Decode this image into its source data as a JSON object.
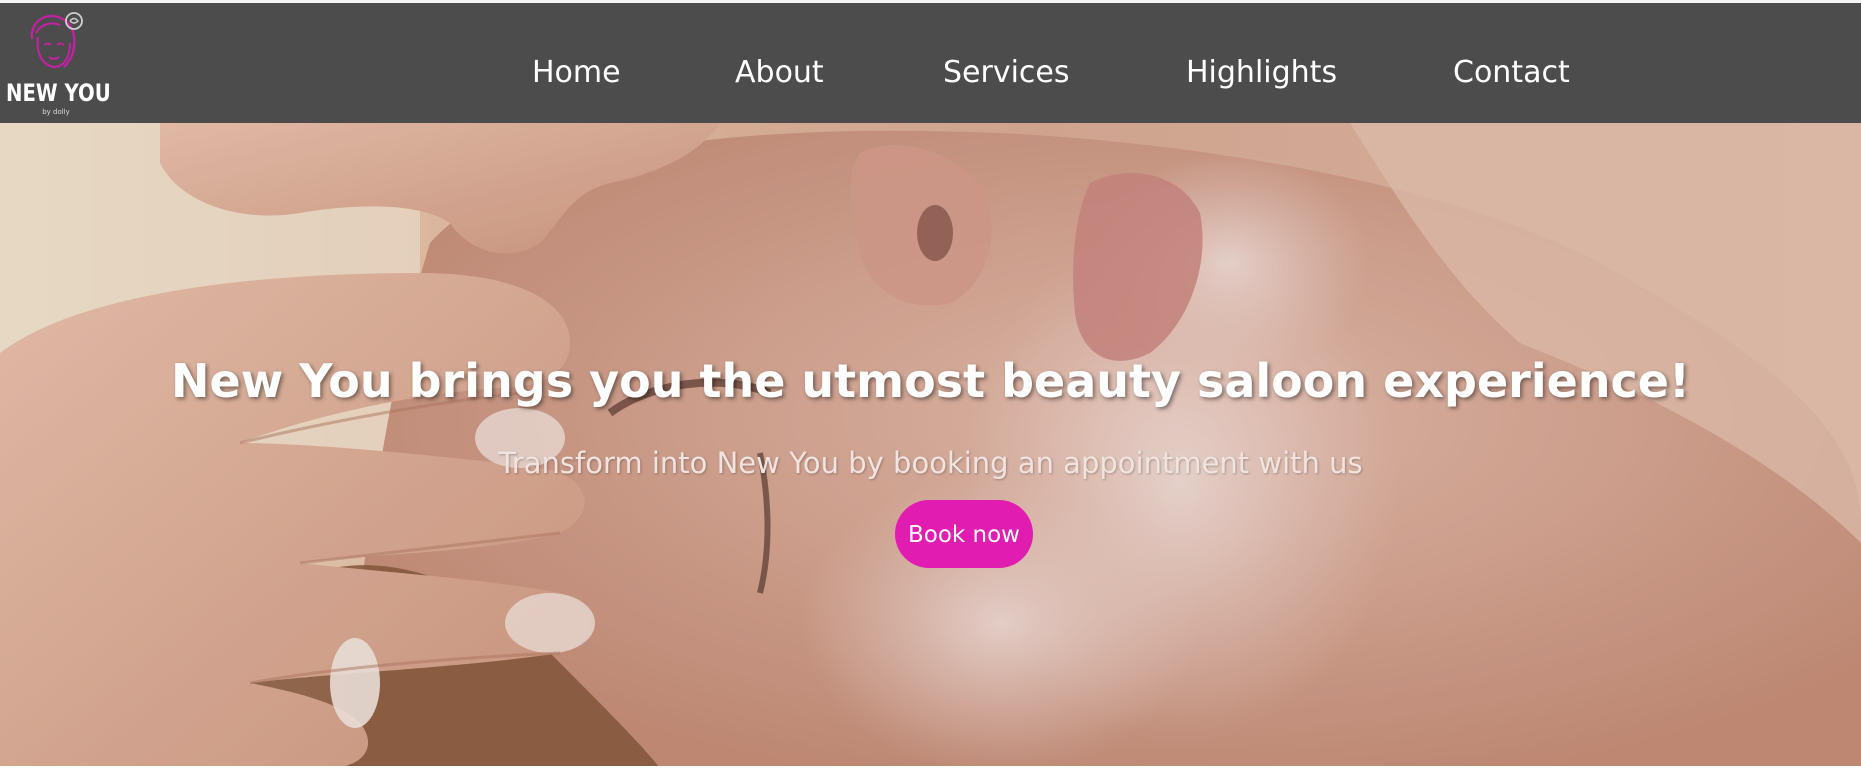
{
  "brand": {
    "name": "NEW YOU",
    "tagline": "by dolly",
    "logo_icon": "woman-face-with-rose-icon",
    "accent_color": "#e01cb1"
  },
  "nav": {
    "items": [
      {
        "label": "Home"
      },
      {
        "label": "About"
      },
      {
        "label": "Services"
      },
      {
        "label": "Highlights"
      },
      {
        "label": "Contact"
      }
    ],
    "background": "#4d4c4d"
  },
  "hero": {
    "title": "New You brings you the utmost beauty saloon experience!",
    "subtitle": "Transform into New You by booking an appointment with us",
    "cta_label": "Book now",
    "cta_color": "#e01cb1"
  }
}
